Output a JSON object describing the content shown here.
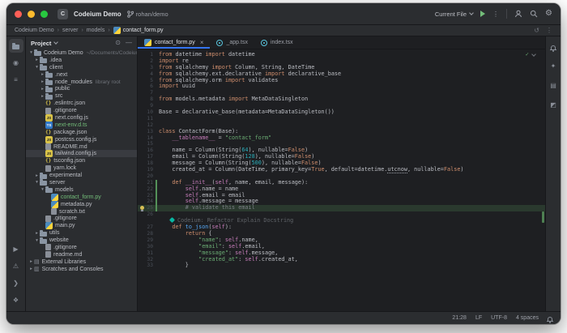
{
  "colors": {
    "accent_blue": "#3574f0",
    "vcs_added_green": "#73bd79",
    "selection_gray": "#393b40",
    "editor_background": "#1e1f22",
    "panel_background": "#2b2d30",
    "caret_line_green": "#2d4233",
    "keyword_orange": "#cf8e6d",
    "string_green": "#6aab73",
    "number_teal": "#2aacb8",
    "codeium_teal": "#09b6a2"
  },
  "window_controls": [
    {
      "name": "close"
    },
    {
      "name": "minimize"
    },
    {
      "name": "zoom"
    }
  ],
  "title_bar": {
    "project_initial": "C",
    "project_name": "Codeium Demo",
    "branch_name": "rohan/demo",
    "run_config": "Current File"
  },
  "nav_bar": {
    "breadcrumbs": [
      {
        "label": "Codeium Demo"
      },
      {
        "label": "server"
      },
      {
        "label": "models"
      },
      {
        "label": "contact_form.py",
        "icon": "python"
      }
    ]
  },
  "tool_strips": {
    "left_top": [
      {
        "name": "project",
        "active": true
      },
      {
        "name": "commit"
      },
      {
        "name": "structure"
      }
    ],
    "left_bottom": [
      {
        "name": "run"
      },
      {
        "name": "problems"
      },
      {
        "name": "terminal"
      },
      {
        "name": "services"
      }
    ],
    "right_top": [
      {
        "name": "notifications"
      },
      {
        "name": "ai-assistant"
      },
      {
        "name": "database"
      },
      {
        "name": "plugins"
      }
    ]
  },
  "project_panel": {
    "title": "Project",
    "tree": [
      {
        "label": "Codeium Demo",
        "extra": "~/Documents/Codeium Demo",
        "icon": "folder",
        "indent": 0,
        "arrow": "open"
      },
      {
        "label": ".idea",
        "icon": "folder",
        "indent": 1,
        "arrow": "closed"
      },
      {
        "label": "client",
        "icon": "folder",
        "indent": 1,
        "arrow": "open"
      },
      {
        "label": ".next",
        "icon": "folder",
        "indent": 2,
        "arrow": "closed"
      },
      {
        "label": "node_modules",
        "extra": "library root",
        "icon": "folder",
        "indent": 2,
        "arrow": "closed"
      },
      {
        "label": "public",
        "icon": "folder",
        "indent": 2,
        "arrow": "closed"
      },
      {
        "label": "src",
        "icon": "folder",
        "indent": 2,
        "arrow": "closed"
      },
      {
        "label": ".eslintrc.json",
        "icon": "json",
        "indent": 2
      },
      {
        "label": ".gitignore",
        "icon": "gitignore",
        "indent": 2
      },
      {
        "label": "next.config.js",
        "icon": "js",
        "indent": 2
      },
      {
        "label": "next-env.d.ts",
        "icon": "ts",
        "indent": 2,
        "cls": "added"
      },
      {
        "label": "package.json",
        "icon": "json",
        "indent": 2
      },
      {
        "label": "postcss.config.js",
        "icon": "js",
        "indent": 2
      },
      {
        "label": "README.md",
        "icon": "md",
        "indent": 2
      },
      {
        "label": "tailwind.config.js",
        "icon": "js",
        "indent": 2,
        "selected": true
      },
      {
        "label": "tsconfig.json",
        "icon": "json",
        "indent": 2
      },
      {
        "label": "yarn.lock",
        "icon": "lock",
        "indent": 2
      },
      {
        "label": "experimental",
        "icon": "folder",
        "indent": 1,
        "arrow": "closed"
      },
      {
        "label": "server",
        "icon": "folder",
        "indent": 1,
        "arrow": "open"
      },
      {
        "label": "models",
        "icon": "folder",
        "indent": 2,
        "arrow": "open"
      },
      {
        "label": "contact_form.py",
        "icon": "python",
        "indent": 3,
        "cls": "added"
      },
      {
        "label": "metadata.py",
        "icon": "python",
        "indent": 3
      },
      {
        "label": "scratch.txt",
        "icon": "txt",
        "indent": 3
      },
      {
        "label": ".gitignore",
        "icon": "gitignore",
        "indent": 2
      },
      {
        "label": "main.py",
        "icon": "python",
        "indent": 2
      },
      {
        "label": "utils",
        "icon": "folder",
        "indent": 1,
        "arrow": "closed"
      },
      {
        "label": "website",
        "icon": "folder",
        "indent": 1,
        "arrow": "open"
      },
      {
        "label": ".gitignore",
        "icon": "gitignore",
        "indent": 2
      },
      {
        "label": "readme.md",
        "icon": "md",
        "indent": 2
      },
      {
        "label": "External Libraries",
        "icon": "library",
        "indent": 0,
        "arrow": "closed"
      },
      {
        "label": "Scratches and Consoles",
        "icon": "scratch",
        "indent": 0,
        "arrow": "closed"
      }
    ]
  },
  "editor": {
    "tabs": [
      {
        "label": "contact_form.py",
        "icon": "python",
        "active": true
      },
      {
        "label": "_app.tsx",
        "icon": "react"
      },
      {
        "label": "index.tsx",
        "icon": "react"
      }
    ],
    "lines": [
      {
        "n": "1",
        "seg": [
          {
            "t": "from ",
            "c": "kw"
          },
          {
            "t": "datetime "
          },
          {
            "t": "import ",
            "c": "kw"
          },
          {
            "t": "datetime"
          }
        ]
      },
      {
        "n": "2",
        "seg": [
          {
            "t": "import ",
            "c": "kw"
          },
          {
            "t": "re"
          }
        ]
      },
      {
        "n": "3",
        "seg": [
          {
            "t": "from ",
            "c": "kw"
          },
          {
            "t": "sqlalchemy "
          },
          {
            "t": "import ",
            "c": "kw"
          },
          {
            "t": "Column, String, DateTime"
          }
        ]
      },
      {
        "n": "4",
        "seg": [
          {
            "t": "from ",
            "c": "kw"
          },
          {
            "t": "sqlalchemy.ext.declarative "
          },
          {
            "t": "import ",
            "c": "kw"
          },
          {
            "t": "declarative_base"
          }
        ]
      },
      {
        "n": "5",
        "seg": [
          {
            "t": "from ",
            "c": "kw"
          },
          {
            "t": "sqlalchemy.orm "
          },
          {
            "t": "import ",
            "c": "kw"
          },
          {
            "t": "validates"
          }
        ]
      },
      {
        "n": "6",
        "seg": [
          {
            "t": "import ",
            "c": "kw"
          },
          {
            "t": "uuid"
          }
        ]
      },
      {
        "n": "7",
        "seg": []
      },
      {
        "n": "8",
        "seg": [
          {
            "t": "from ",
            "c": "kw"
          },
          {
            "t": "models.metadata "
          },
          {
            "t": "import ",
            "c": "kw"
          },
          {
            "t": "MetaDataSingleton"
          }
        ]
      },
      {
        "n": "9",
        "seg": []
      },
      {
        "n": "10",
        "seg": [
          {
            "t": "Base = declarative_base(metadata=MetaDataSingleton())"
          }
        ]
      },
      {
        "n": "11",
        "seg": []
      },
      {
        "n": "12",
        "seg": []
      },
      {
        "n": "13",
        "seg": [
          {
            "t": "class ",
            "c": "kw"
          },
          {
            "t": "ContactForm(Base):"
          }
        ]
      },
      {
        "n": "14",
        "seg": [
          {
            "t": "    "
          },
          {
            "t": "__tablename__ ",
            "c": "self"
          },
          {
            "t": "= "
          },
          {
            "t": "\"contact_form\"",
            "c": "str"
          }
        ]
      },
      {
        "n": "15",
        "seg": []
      },
      {
        "n": "16",
        "seg": [
          {
            "t": "    name = Column(String("
          },
          {
            "t": "64",
            "c": "num"
          },
          {
            "t": "), nullable="
          },
          {
            "t": "False",
            "c": "kw"
          },
          {
            "t": ")"
          }
        ]
      },
      {
        "n": "17",
        "seg": [
          {
            "t": "    email = Column(String("
          },
          {
            "t": "128",
            "c": "num"
          },
          {
            "t": "), nullable="
          },
          {
            "t": "False",
            "c": "kw"
          },
          {
            "t": ")"
          }
        ]
      },
      {
        "n": "18",
        "seg": [
          {
            "t": "    message = Column(String("
          },
          {
            "t": "500",
            "c": "num"
          },
          {
            "t": "), nullable="
          },
          {
            "t": "False",
            "c": "kw"
          },
          {
            "t": ")"
          }
        ]
      },
      {
        "n": "19",
        "seg": [
          {
            "t": "    created_at = Column(DateTime, primary_key="
          },
          {
            "t": "True",
            "c": "kw"
          },
          {
            "t": ", default=datetime."
          },
          {
            "t": "utcnow",
            "c": "warn"
          },
          {
            "t": ", nullable="
          },
          {
            "t": "False",
            "c": "kw"
          },
          {
            "t": ")"
          }
        ]
      },
      {
        "n": "20",
        "seg": []
      },
      {
        "n": "21",
        "chg": true,
        "seg": [
          {
            "t": "    "
          },
          {
            "t": "def ",
            "c": "kw"
          },
          {
            "t": "__init__",
            "c": "self"
          },
          {
            "t": "("
          },
          {
            "t": "self",
            "c": "self"
          },
          {
            "t": ", name, email, message):"
          }
        ]
      },
      {
        "n": "22",
        "chg": true,
        "seg": [
          {
            "t": "        "
          },
          {
            "t": "self",
            "c": "self"
          },
          {
            "t": ".name = name"
          }
        ]
      },
      {
        "n": "23",
        "chg": true,
        "seg": [
          {
            "t": "        "
          },
          {
            "t": "self",
            "c": "self"
          },
          {
            "t": ".email = email"
          }
        ]
      },
      {
        "n": "24",
        "chg": true,
        "seg": [
          {
            "t": "        "
          },
          {
            "t": "self",
            "c": "self"
          },
          {
            "t": ".message = message"
          }
        ]
      },
      {
        "n": "25",
        "chg": true,
        "hl": true,
        "bulb": true,
        "seg": [
          {
            "t": "        "
          },
          {
            "t": "# validate this email",
            "c": "cm"
          }
        ]
      },
      {
        "n": "26",
        "seg": []
      },
      {
        "n": "",
        "hint": true,
        "seg": [
          {
            "t": "Codeium: Refactor Explain Docstring",
            "c": "hint"
          }
        ]
      },
      {
        "n": "27",
        "seg": [
          {
            "t": "    "
          },
          {
            "t": "def ",
            "c": "kw"
          },
          {
            "t": "to_json",
            "c": "fn"
          },
          {
            "t": "("
          },
          {
            "t": "self",
            "c": "self"
          },
          {
            "t": "):"
          }
        ]
      },
      {
        "n": "28",
        "seg": [
          {
            "t": "        "
          },
          {
            "t": "return ",
            "c": "kw"
          },
          {
            "t": "{"
          }
        ]
      },
      {
        "n": "29",
        "seg": [
          {
            "t": "            "
          },
          {
            "t": "\"name\"",
            "c": "str"
          },
          {
            "t": ": "
          },
          {
            "t": "self",
            "c": "self"
          },
          {
            "t": ".name,"
          }
        ]
      },
      {
        "n": "30",
        "seg": [
          {
            "t": "            "
          },
          {
            "t": "\"email\"",
            "c": "str"
          },
          {
            "t": ": "
          },
          {
            "t": "self",
            "c": "self"
          },
          {
            "t": ".email,"
          }
        ]
      },
      {
        "n": "31",
        "seg": [
          {
            "t": "            "
          },
          {
            "t": "\"message\"",
            "c": "str"
          },
          {
            "t": ": "
          },
          {
            "t": "self",
            "c": "self"
          },
          {
            "t": ".message,"
          }
        ]
      },
      {
        "n": "32",
        "seg": [
          {
            "t": "            "
          },
          {
            "t": "\"created_at\"",
            "c": "str"
          },
          {
            "t": ": "
          },
          {
            "t": "self",
            "c": "self"
          },
          {
            "t": ".created_at,"
          }
        ]
      },
      {
        "n": "33",
        "seg": [
          {
            "t": "        }"
          }
        ]
      }
    ]
  },
  "status_bar": {
    "items": [
      {
        "name": "cursor-position",
        "label": "21:28"
      },
      {
        "name": "line-separator",
        "label": "LF"
      },
      {
        "name": "file-encoding",
        "label": "UTF-8"
      },
      {
        "name": "indent-style",
        "label": "4 spaces"
      }
    ]
  }
}
